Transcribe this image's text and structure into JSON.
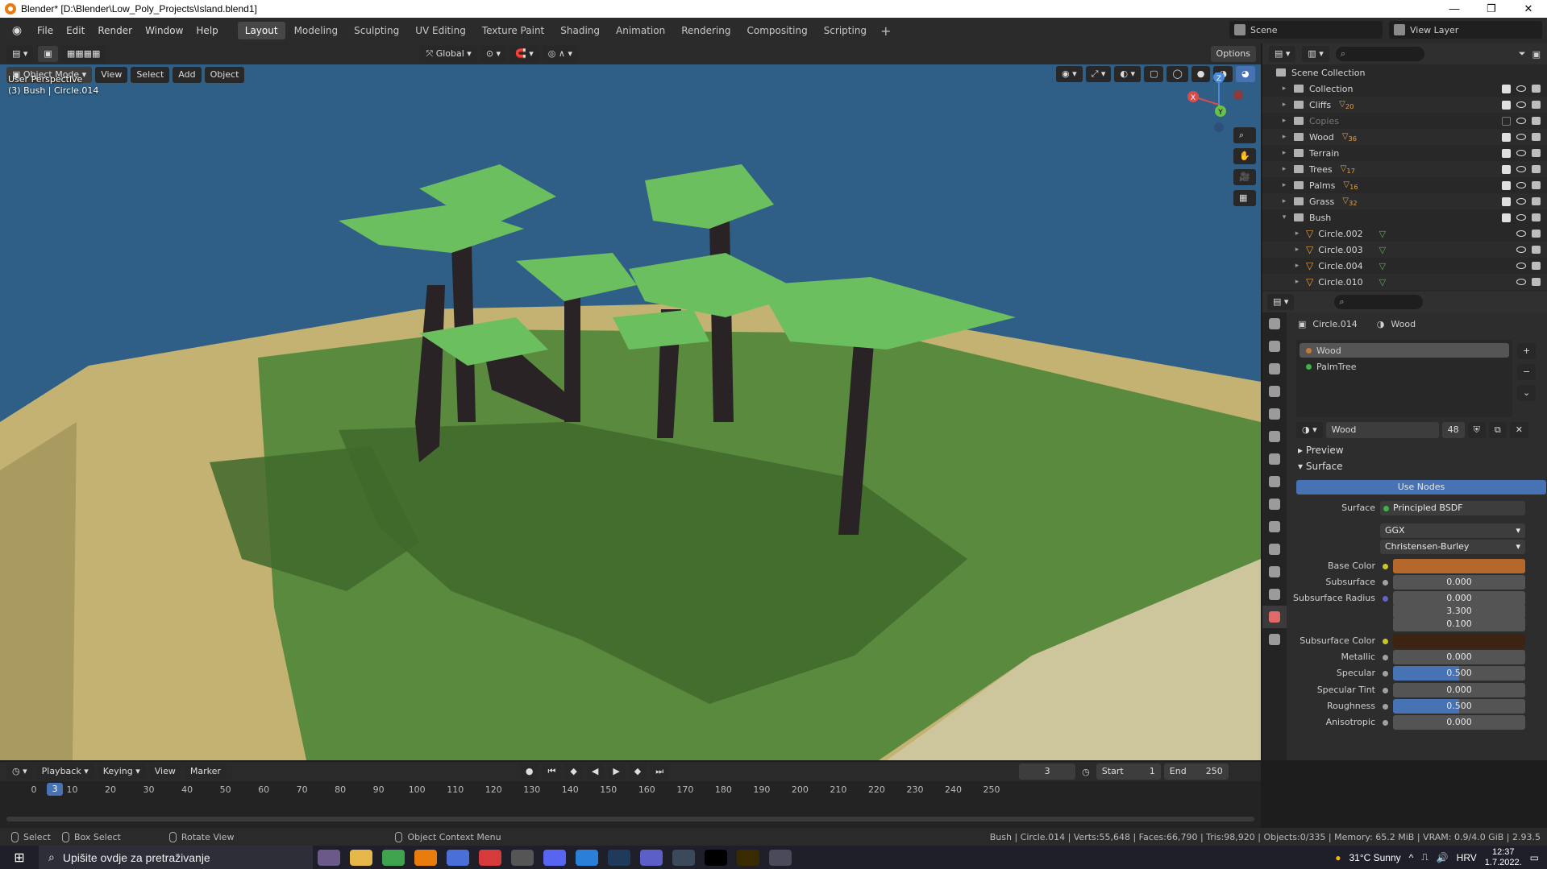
{
  "window": {
    "title": "Blender* [D:\\Blender\\Low_Poly_Projects\\Island.blend1]",
    "minimize": "—",
    "maximize": "❐",
    "close": "✕"
  },
  "menu": {
    "items": [
      "File",
      "Edit",
      "Render",
      "Window",
      "Help"
    ],
    "workspaces": [
      "Layout",
      "Modeling",
      "Sculpting",
      "UV Editing",
      "Texture Paint",
      "Shading",
      "Animation",
      "Rendering",
      "Compositing",
      "Scripting"
    ],
    "active_workspace": "Layout",
    "add_workspace": "+",
    "scene": "Scene",
    "view_layer": "View Layer"
  },
  "viewport": {
    "transform_orientation": "Global",
    "options": "Options",
    "mode": "Object Mode",
    "menus": [
      "View",
      "Select",
      "Add",
      "Object"
    ],
    "perspective": "User Perspective",
    "active_info": "(3) Bush | Circle.014",
    "gizmo_axes": {
      "x": "X",
      "y": "Y",
      "z": "Z"
    },
    "colors": {
      "sky": "#2f5f86",
      "sand": "#c4b272",
      "grass": "#5a8a3e",
      "shadow": "#3f6b2c",
      "trunk": "#2a2326",
      "leaf": "#6bbf5e"
    }
  },
  "outliner": {
    "root": "Scene Collection",
    "rows": [
      {
        "name": "Collection",
        "badge": "",
        "checked": true
      },
      {
        "name": "Cliffs",
        "badge": "20",
        "checked": true
      },
      {
        "name": "Copies",
        "badge": "",
        "checked": false
      },
      {
        "name": "Wood",
        "badge": "36",
        "checked": true
      },
      {
        "name": "Terrain",
        "badge": "",
        "checked": true
      },
      {
        "name": "Trees",
        "badge": "17",
        "checked": true
      },
      {
        "name": "Palms",
        "badge": "16",
        "checked": true
      },
      {
        "name": "Grass",
        "badge": "32",
        "checked": true
      },
      {
        "name": "Bush",
        "badge": "",
        "checked": true
      }
    ],
    "children": [
      "Circle.002",
      "Circle.003",
      "Circle.004",
      "Circle.010"
    ]
  },
  "properties": {
    "object": "Circle.014",
    "material": "Wood",
    "slots": [
      "Wood",
      "PalmTree"
    ],
    "material_field": "Wood",
    "users": "48",
    "panels": {
      "preview": "Preview",
      "surface": "Surface"
    },
    "use_nodes": "Use Nodes",
    "surface_label": "Surface",
    "surface_value": "Principled BSDF",
    "distribution": "GGX",
    "subsurface_method": "Christensen-Burley",
    "fields": [
      {
        "label": "Base Color",
        "value": "",
        "kind": "color",
        "color": "#b5682c"
      },
      {
        "label": "Subsurface",
        "value": "0.000",
        "kind": "num"
      },
      {
        "label": "Subsurface Radius",
        "value": "0.000",
        "kind": "num"
      },
      {
        "label": "",
        "value": "3.300",
        "kind": "num"
      },
      {
        "label": "",
        "value": "0.100",
        "kind": "num"
      },
      {
        "label": "Subsurface Color",
        "value": "",
        "kind": "color",
        "color": "#3d2412"
      },
      {
        "label": "Metallic",
        "value": "0.000",
        "kind": "num"
      },
      {
        "label": "Specular",
        "value": "0.500",
        "kind": "slider",
        "fill": 0.5
      },
      {
        "label": "Specular Tint",
        "value": "0.000",
        "kind": "num"
      },
      {
        "label": "Roughness",
        "value": "0.500",
        "kind": "slider",
        "fill": 0.5
      },
      {
        "label": "Anisotropic",
        "value": "0.000",
        "kind": "num"
      }
    ]
  },
  "timeline": {
    "menus": [
      "Playback",
      "Keying",
      "View",
      "Marker"
    ],
    "current_frame": "3",
    "start_label": "Start",
    "start": "1",
    "end_label": "End",
    "end": "250",
    "ticks": [
      "0",
      "10",
      "20",
      "30",
      "40",
      "50",
      "60",
      "70",
      "80",
      "90",
      "100",
      "110",
      "120",
      "130",
      "140",
      "150",
      "160",
      "170",
      "180",
      "190",
      "200",
      "210",
      "220",
      "230",
      "240",
      "250"
    ]
  },
  "statusbar": {
    "select": "Select",
    "box_select": "Box Select",
    "rotate": "Rotate View",
    "context": "Object Context Menu",
    "stats": "Bush | Circle.014 | Verts:55,648 | Faces:66,790 | Tris:98,920 | Objects:0/335 | Memory: 65.2 MiB | VRAM: 0.9/4.0 GiB | 2.93.5"
  },
  "taskbar": {
    "search_placeholder": "Upišite ovdje za pretraživanje",
    "weather": "31°C  Sunny",
    "lang": "HRV",
    "time": "12:37",
    "date": "1.7.2022."
  }
}
